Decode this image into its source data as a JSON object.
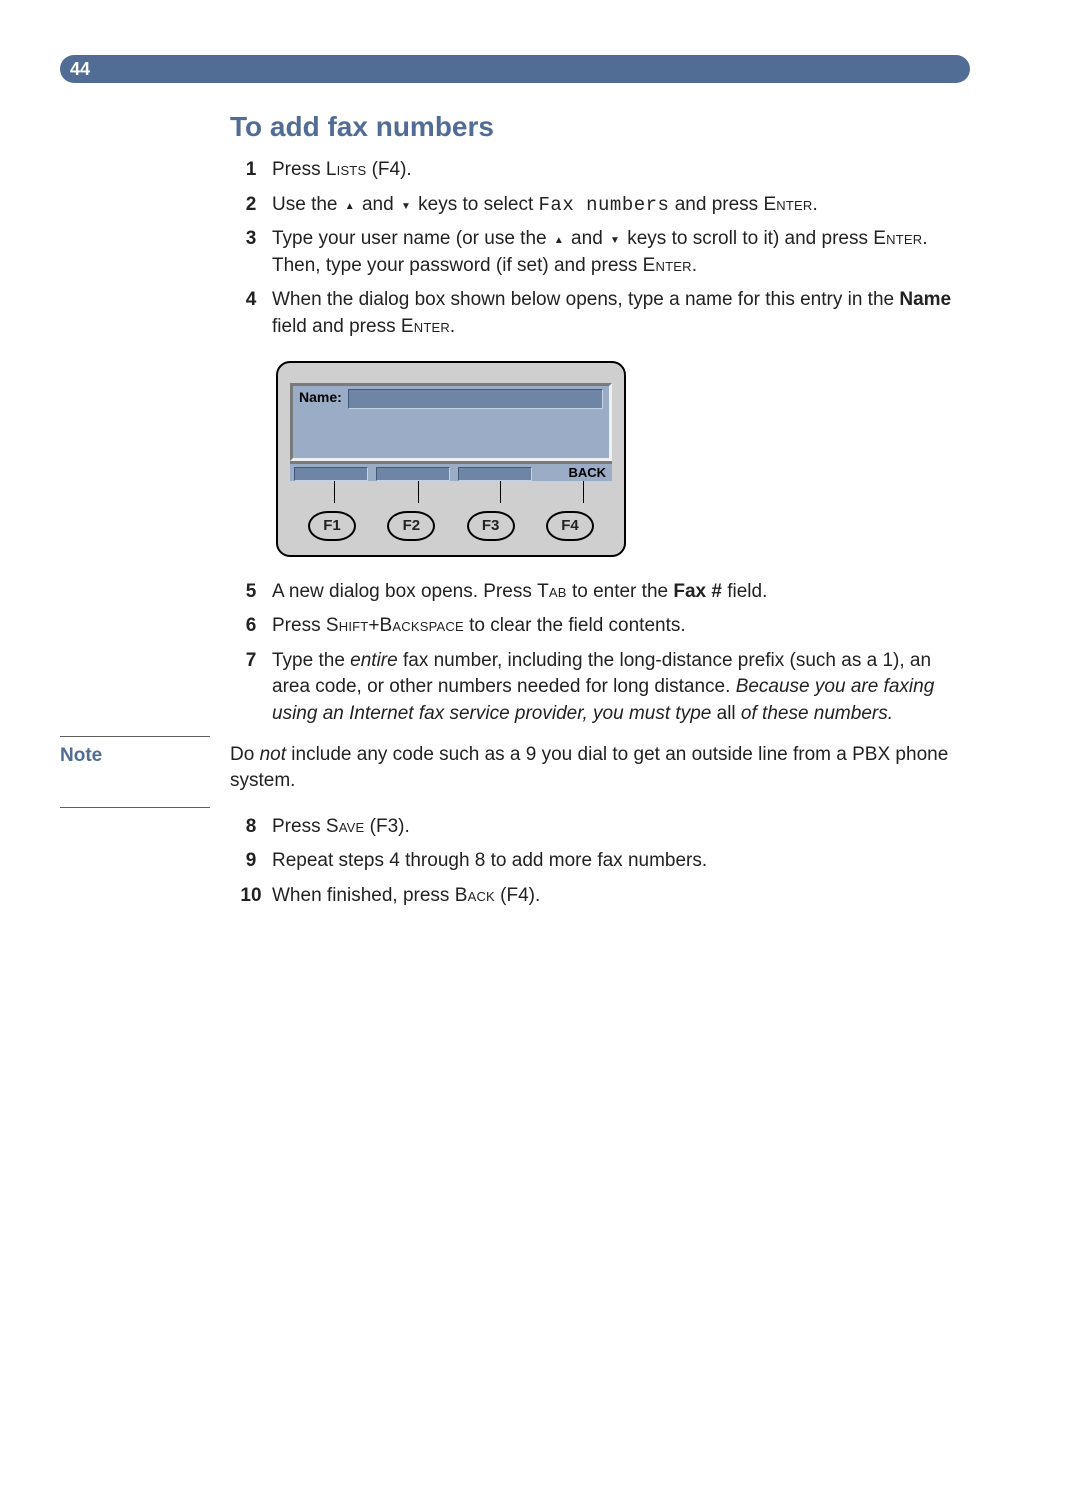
{
  "page_number": "44",
  "title": "To add fax numbers",
  "steps": {
    "s1": {
      "num": "1",
      "pre": "Press ",
      "key": "Lists",
      "post": " (F4)."
    },
    "s2": {
      "num": "2",
      "a": "Use the ",
      "b": " and ",
      "c": " keys to select ",
      "mono": "Fax numbers",
      "d": " and press ",
      "key": "Enter",
      "e": "."
    },
    "s3": {
      "num": "3",
      "a": "Type your user name (or use the ",
      "b": " and ",
      "c": " keys to scroll to it) and press ",
      "key1": "Enter",
      "d": ". Then, type your password (if set) and press ",
      "key2": "Enter",
      "e": "."
    },
    "s4": {
      "num": "4",
      "a": "When the dialog box shown below opens, type a name for this entry in the ",
      "bold": "Name",
      "b": " field and press ",
      "key": "Enter",
      "c": "."
    },
    "s5": {
      "num": "5",
      "a": "A new dialog box opens. Press ",
      "key": "Tab",
      "b": " to enter the ",
      "bold": "Fax #",
      "c": " field."
    },
    "s6": {
      "num": "6",
      "a": "Press ",
      "key1": "Shift",
      "plus": "+",
      "key2": "Backspace",
      "b": " to clear the field contents."
    },
    "s7": {
      "num": "7",
      "a": "Type the ",
      "ital1": "entire",
      "b": " fax number, including the long-distance prefix (such as a 1), an area code, or other numbers needed for long distance. ",
      "ital2": "Because you are faxing using an Internet fax service provider, you must type ",
      "plain_in_ital": "all",
      "ital3": " of these numbers."
    },
    "s8": {
      "num": "8",
      "a": "Press ",
      "key": "Save",
      "b": " (F3)."
    },
    "s9": {
      "num": "9",
      "a": "Repeat steps 4 through 8 to add more fax numbers."
    },
    "s10": {
      "num": "10",
      "a": "When finished, press ",
      "key": "Back",
      "b": " (F4)."
    }
  },
  "note": {
    "label": "Note",
    "a": "Do ",
    "ital": "not ",
    "b": "include any code such as a 9 you dial to get an outside line from a PBX phone system."
  },
  "dialog": {
    "name_label": "Name:",
    "back_label": "BACK",
    "fkeys": [
      "F1",
      "F2",
      "F3",
      "F4"
    ]
  }
}
